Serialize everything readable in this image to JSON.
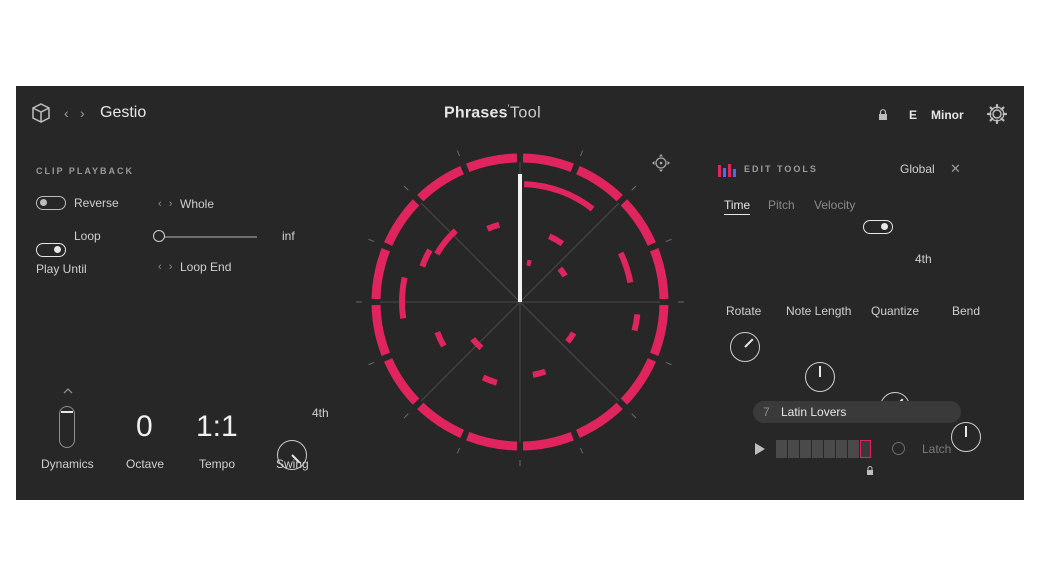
{
  "header": {
    "title": "Gestio",
    "brand_main": "Phrases",
    "brand_sub": "Tool",
    "key": "E",
    "scale": "Minor"
  },
  "clip_playback": {
    "label": "CLIP PLAYBACK",
    "reverse_label": "Reverse",
    "reverse_on": false,
    "loop_label": "Loop",
    "loop_on": true,
    "play_until_label": "Play Until",
    "whole_value": "Whole",
    "loop_end_value": "Loop End",
    "slider_max_label": "inf"
  },
  "bottom_controls": {
    "dynamics_label": "Dynamics",
    "octave_value": "0",
    "octave_label": "Octave",
    "tempo_value": "1:1",
    "tempo_label": "Tempo",
    "swing_label": "Swing",
    "swing_badge": "4th"
  },
  "edit_tools": {
    "label": "EDIT TOOLS",
    "global_label": "Global",
    "global_on": true,
    "tabs": [
      "Time",
      "Pitch",
      "Velocity"
    ],
    "active_tab": "Time",
    "knobs": [
      {
        "label": "Rotate"
      },
      {
        "label": "Note Length"
      },
      {
        "label": "Quantize"
      },
      {
        "label": "Bend"
      }
    ],
    "quantize_badge": "4th"
  },
  "preset": {
    "number": "7",
    "name": "Latin Lovers"
  },
  "sequencer": {
    "latch_label": "Latch",
    "steps": 8,
    "current_step": 8
  },
  "colors": {
    "accent": "#e0245e",
    "background": "#272727"
  }
}
